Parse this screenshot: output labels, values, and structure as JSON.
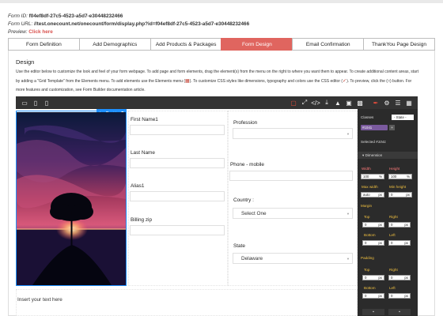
{
  "meta": {
    "form_id_label": "Form ID:",
    "form_id": "f04ef8df-27c5-4523-a5d7-e30448232466",
    "form_url_label": "Form URL:",
    "form_url": "//test.onecount.net/onecount/form/display.php?id=f04ef8df-27c5-4523-a5d7-e30448232466",
    "preview_label": "Preview:",
    "preview_link": "Click here"
  },
  "tabs": [
    {
      "label": "Form Definition",
      "active": false
    },
    {
      "label": "Add Demographics",
      "active": false
    },
    {
      "label": "Add Products & Packages",
      "active": false
    },
    {
      "label": "Form Design",
      "active": true
    },
    {
      "label": "Email Confirmation",
      "active": false
    },
    {
      "label": "ThankYou Page Design",
      "active": false
    }
  ],
  "design": {
    "heading": "Design",
    "desc_part1": "Use the editor below to customize the look and feel of your form webpage. To add page and form elements, drag the element(s) from the menu on the right to where you want them to appear. To create additional content areas, start by adding a \"Grid Template\" from the Elements menu. To add elements use the Elements menu (",
    "desc_part2": "). To customize CSS styles like dimensions, typography and colors use the CSS editor (",
    "desc_part3": "). To preview, click the (",
    "desc_part4": ") button. For more features and customization, see Form Builder documentation article."
  },
  "form": {
    "first_name": "First Name1",
    "last_name": "Last Name",
    "alias": "Alias1",
    "billing_zip": "Billing zip",
    "profession": "Profession",
    "phone": "Phone - mobile",
    "country": "Country :",
    "country_value": "Select One",
    "state": "State",
    "state_value": "Delaware",
    "insert_text": "Insert your text here"
  },
  "style_panel": {
    "classes_label": "Classes",
    "state_value": "- State -",
    "class_chip": "#1041",
    "selected_label": "Selected",
    "selected_value": "#1041",
    "dimension_label": "Dimension",
    "width_label": "Width",
    "height_label": "Height",
    "width_value": "100",
    "width_unit": "%",
    "height_value": "100",
    "height_unit": "%",
    "max_width_label": "Max width",
    "min_height_label": "Min height",
    "max_width_value": "auto",
    "max_width_unit": "px",
    "min_height_value": "0",
    "min_height_unit": "px",
    "margin_label": "Margin",
    "padding_label": "Padding",
    "top_label": "Top",
    "right_label": "Right",
    "bottom_label": "Bottom",
    "left_label": "Left",
    "zero": "0",
    "px": "px"
  }
}
